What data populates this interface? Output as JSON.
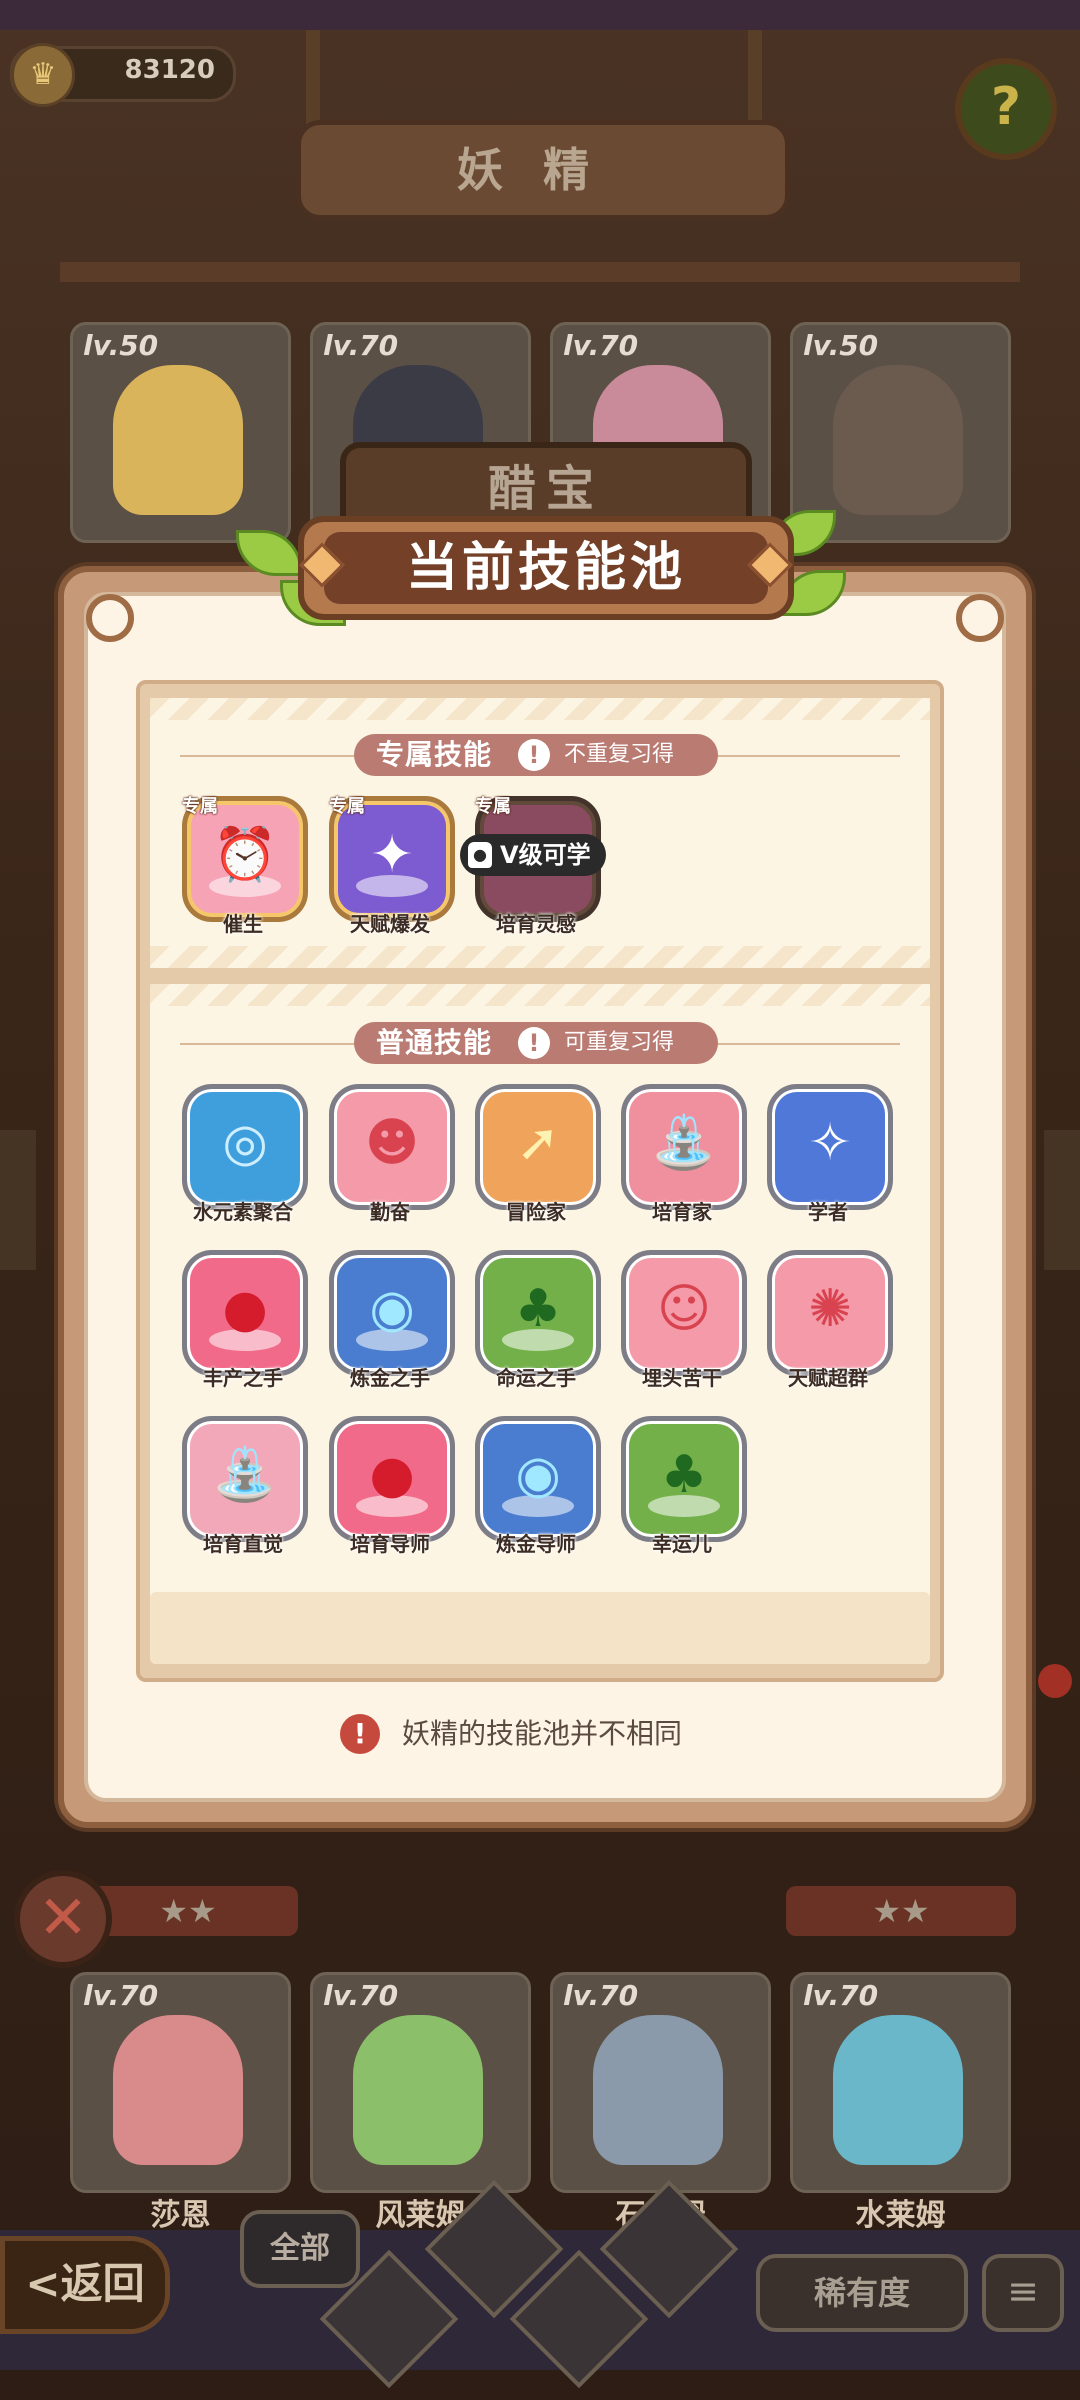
{
  "status": {
    "coins": "83120"
  },
  "header": {
    "screen_title": "妖精",
    "help_label": "?"
  },
  "fairy": {
    "name": "醋宝"
  },
  "grid_top": [
    {
      "level": "lv.50",
      "color": "#d9b45a"
    },
    {
      "level": "lv.70",
      "color": "#3b3b46"
    },
    {
      "level": "lv.70",
      "color": "#c98a9a"
    },
    {
      "level": "lv.50",
      "color": "#6b5a4e"
    }
  ],
  "grid_bottom": [
    {
      "level": "lv.70",
      "name": "莎恩",
      "color": "#d98a8a"
    },
    {
      "level": "lv.70",
      "name": "风莱姆",
      "color": "#8bbf6a"
    },
    {
      "level": "lv.70",
      "name": "石莱姆",
      "color": "#8a9aaa"
    },
    {
      "level": "lv.70",
      "name": "水莱姆",
      "color": "#6ab7c9"
    }
  ],
  "dialog": {
    "title": "当前技能池",
    "exclusive": {
      "title": "专属技能",
      "note": "不重复习得",
      "tag": "专属",
      "lock_text": "V级可学",
      "skills": [
        {
          "name": "催生",
          "glyph": "⏰",
          "bg": "#f7a3b6",
          "style": "gold"
        },
        {
          "name": "天赋爆发",
          "glyph": "✦",
          "bg": "#7d5bd1",
          "style": "gold"
        },
        {
          "name": "培育灵感",
          "glyph": "❀",
          "bg": "#c56b8a",
          "style": "locked"
        }
      ]
    },
    "common": {
      "title": "普通技能",
      "note": "可重复习得",
      "skills": [
        {
          "name": "水元素聚合",
          "glyph": "◎",
          "bg": "#3f9fdd"
        },
        {
          "name": "勤奋",
          "glyph": "☻",
          "bg": "#f49aa8"
        },
        {
          "name": "冒险家",
          "glyph": "➚",
          "bg": "#f0a35a"
        },
        {
          "name": "培育家",
          "glyph": "⛲",
          "bg": "#f08f9e"
        },
        {
          "name": "学者",
          "glyph": "✧",
          "bg": "#4f78d8"
        },
        {
          "name": "丰产之手",
          "glyph": "●",
          "bg": "#f26a8a"
        },
        {
          "name": "炼金之手",
          "glyph": "◉",
          "bg": "#4a7ccf"
        },
        {
          "name": "命运之手",
          "glyph": "♣",
          "bg": "#74b04a"
        },
        {
          "name": "埋头苦干",
          "glyph": "☺",
          "bg": "#f49aa8"
        },
        {
          "name": "天赋超群",
          "glyph": "✺",
          "bg": "#f49aa8"
        },
        {
          "name": "培育直觉",
          "glyph": "⛲",
          "bg": "#f2a8b8"
        },
        {
          "name": "培育导师",
          "glyph": "●",
          "bg": "#f26a8a"
        },
        {
          "name": "炼金导师",
          "glyph": "◉",
          "bg": "#4a7ccf"
        },
        {
          "name": "幸运儿",
          "glyph": "♣",
          "bg": "#74b04a"
        }
      ]
    },
    "footer": "妖精的技能池并不相同"
  },
  "bottom": {
    "back_label": "返回",
    "filter_all": "全部",
    "rarity_label": "稀有度",
    "sort_icon": "≡",
    "close_icon": "✕",
    "stars": "★★"
  }
}
